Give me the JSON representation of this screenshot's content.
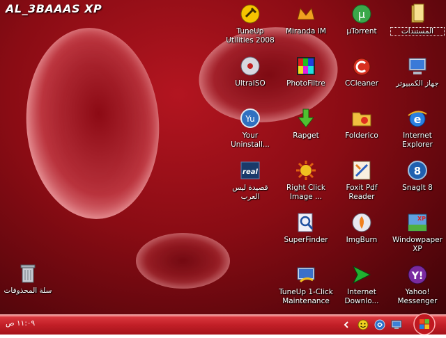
{
  "desktop": {
    "watermark": "AL_3BAAAS XP",
    "icons": [
      {
        "label": "TuneUp Utilities 2008",
        "glyph": "tuneup-utilities-icon"
      },
      {
        "label": "Miranda IM",
        "glyph": "miranda-im-icon"
      },
      {
        "label": "µTorrent",
        "glyph": "utorrent-icon"
      },
      {
        "label": "المستندات",
        "glyph": "documents-folder-icon"
      },
      {
        "label": "UltraISO",
        "glyph": "ultraiso-icon"
      },
      {
        "label": "PhotoFiltre",
        "glyph": "photofiltre-icon"
      },
      {
        "label": "CCleaner",
        "glyph": "ccleaner-icon"
      },
      {
        "label": "جهاز الكمبيوتر",
        "glyph": "my-computer-icon"
      },
      {
        "label": "Your Uninstall...",
        "glyph": "your-uninstaller-icon"
      },
      {
        "label": "Rapget",
        "glyph": "rapget-icon"
      },
      {
        "label": "Folderico",
        "glyph": "folderico-icon"
      },
      {
        "label": "Internet Explorer",
        "glyph": "internet-explorer-icon"
      },
      {
        "label": "قصيدة ليس العرب",
        "glyph": "realplayer-icon"
      },
      {
        "label": "Right Click Image ...",
        "glyph": "right-click-image-icon"
      },
      {
        "label": "Foxit Pdf Reader",
        "glyph": "foxit-pdf-reader-icon"
      },
      {
        "label": "SnagIt 8",
        "glyph": "snagit-icon"
      },
      {
        "label": "SuperFinder",
        "glyph": "superfinder-icon"
      },
      {
        "label": "ImgBurn",
        "glyph": "imgburn-icon"
      },
      {
        "label": "Windowpaper XP",
        "glyph": "windowpaper-xp-icon"
      },
      {
        "label": "TuneUp 1-Click Maintenance",
        "glyph": "tuneup-1click-icon"
      },
      {
        "label": "Internet Downlo...",
        "glyph": "internet-download-icon"
      },
      {
        "label": "Yahoo! Messenger",
        "glyph": "yahoo-messenger-icon"
      },
      {
        "label": "سلة المحذوفات",
        "glyph": "recycle-bin-icon"
      }
    ]
  },
  "taskbar": {
    "clock": "١١:٠٩ ص",
    "tray_icons": [
      "chevron-left-icon",
      "yahoo-tray-icon",
      "snagit-tray-icon",
      "network-tray-icon"
    ],
    "start_button": "start-orb-icon"
  },
  "colors": {
    "taskbar": "#c21f27",
    "desktop": "#8a0c14"
  }
}
